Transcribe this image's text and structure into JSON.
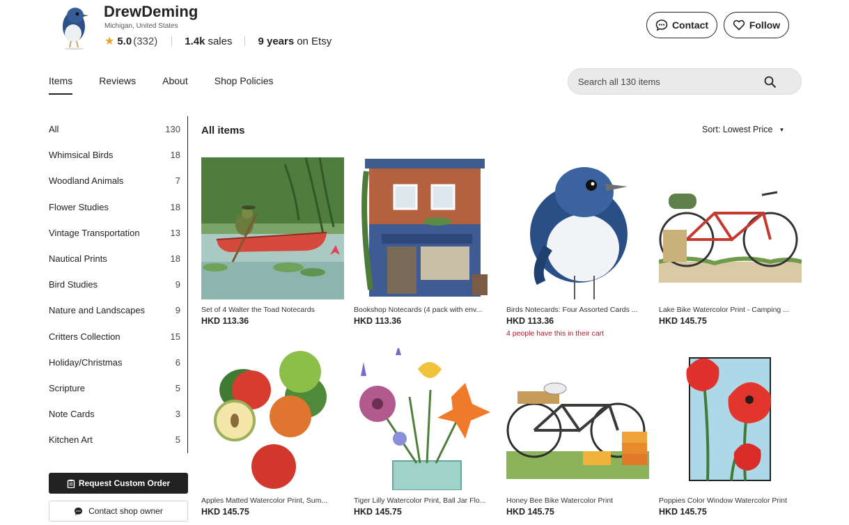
{
  "shop": {
    "name": "DrewDeming",
    "location": "Michigan, United States",
    "rating": "5.0",
    "review_count": "(332)",
    "sales_value": "1.4k",
    "sales_label": "sales",
    "years_value": "9 years",
    "years_label": "on Etsy",
    "contact_label": "Contact",
    "follow_label": "Follow"
  },
  "tabs": [
    "Items",
    "Reviews",
    "About",
    "Shop Policies"
  ],
  "search": {
    "placeholder": "Search all 130 items"
  },
  "sidebar": {
    "categories": [
      {
        "label": "All",
        "count": "130"
      },
      {
        "label": "Whimsical Birds",
        "count": "18"
      },
      {
        "label": "Woodland Animals",
        "count": "7"
      },
      {
        "label": "Flower Studies",
        "count": "18"
      },
      {
        "label": "Vintage Transportation",
        "count": "13"
      },
      {
        "label": "Nautical Prints",
        "count": "18"
      },
      {
        "label": "Bird Studies",
        "count": "9"
      },
      {
        "label": "Nature and Landscapes",
        "count": "9"
      },
      {
        "label": "Critters Collection",
        "count": "15"
      },
      {
        "label": "Holiday/Christmas",
        "count": "6"
      },
      {
        "label": "Scripture",
        "count": "5"
      },
      {
        "label": "Note Cards",
        "count": "3"
      },
      {
        "label": "Kitchen Art",
        "count": "5"
      }
    ],
    "request_label": "Request Custom Order",
    "contact_owner_label": "Contact shop owner"
  },
  "main": {
    "title": "All items",
    "sort_label": "Sort: Lowest Price"
  },
  "items": [
    {
      "title": "Set of 4 Walter the Toad Notecards",
      "price": "HKD 113.36",
      "image": "toad-canoe"
    },
    {
      "title": "Bookshop Notecards (4 pack with env...",
      "price": "HKD 113.36",
      "image": "bookshop"
    },
    {
      "title": "Birds Notecards: Four Assorted Cards ...",
      "price": "HKD 113.36",
      "note": "4 people have this in their cart",
      "image": "blue-bird"
    },
    {
      "title": "Lake Bike Watercolor Print - Camping ...",
      "price": "HKD 145.75",
      "image": "red-bike"
    },
    {
      "title": "Apples Matted Watercolor Print, Sum...",
      "price": "HKD 145.75",
      "image": "apples"
    },
    {
      "title": "Tiger Lilly Watercolor Print, Ball Jar Flo...",
      "price": "HKD 145.75",
      "image": "flowers-jar"
    },
    {
      "title": "Honey Bee Bike Watercolor Print",
      "price": "HKD 145.75",
      "image": "bee-bike"
    },
    {
      "title": "Poppies Color Window Watercolor Print",
      "price": "HKD 145.75",
      "image": "poppies"
    }
  ],
  "colors": {
    "star": "#e8a71a",
    "cart_note": "#a61a2e",
    "dark_button": "#222222"
  }
}
